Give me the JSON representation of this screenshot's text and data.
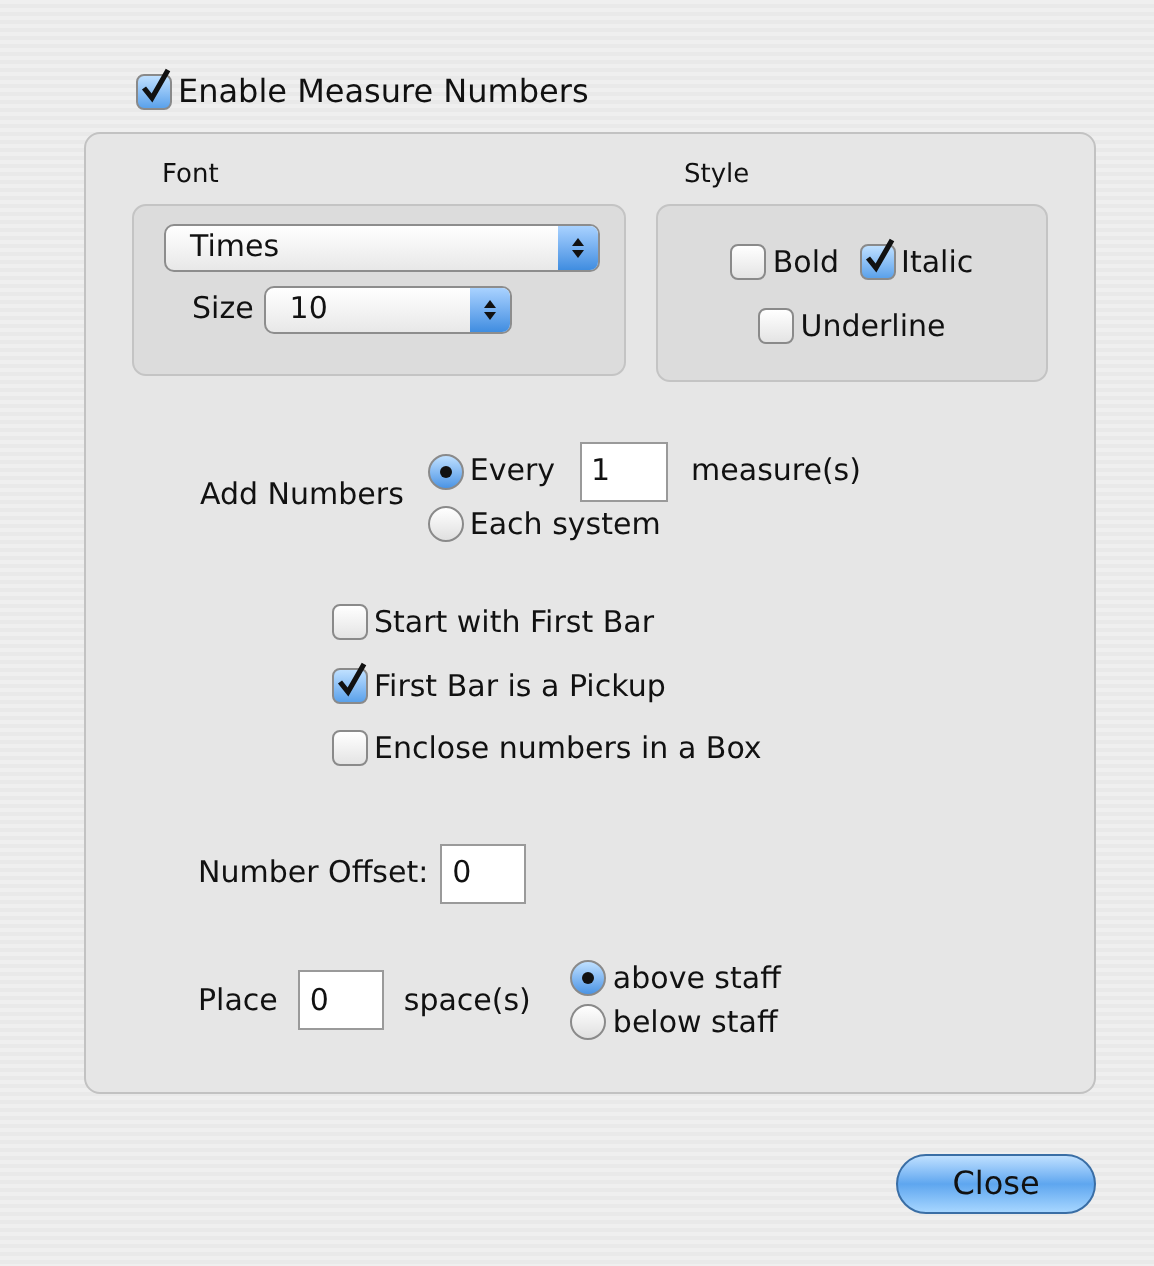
{
  "enable": {
    "label": "Enable Measure Numbers",
    "checked": true
  },
  "font_group": {
    "title": "Font",
    "font_select": {
      "value": "Times"
    },
    "size_label": "Size",
    "size_select": {
      "value": "10"
    }
  },
  "style_group": {
    "title": "Style",
    "options": [
      {
        "label": "Bold",
        "checked": false
      },
      {
        "label": "Italic",
        "checked": true
      },
      {
        "label": "Underline",
        "checked": false
      }
    ]
  },
  "add_numbers": {
    "label": "Add Numbers",
    "options": [
      {
        "label": "Every",
        "selected": true
      },
      {
        "label": "Each system",
        "selected": false
      }
    ],
    "every_value": "1",
    "unit": "measure(s)"
  },
  "checkboxes": [
    {
      "label": "Start with First Bar",
      "checked": false
    },
    {
      "label": "First Bar is a Pickup",
      "checked": true
    },
    {
      "label": "Enclose numbers in a Box",
      "checked": false
    }
  ],
  "offset": {
    "label": "Number Offset:",
    "value": "0"
  },
  "place": {
    "label": "Place",
    "value": "0",
    "unit": "space(s)",
    "options": [
      {
        "label": "above staff",
        "selected": true
      },
      {
        "label": "below staff",
        "selected": false
      }
    ]
  },
  "close_button": "Close"
}
